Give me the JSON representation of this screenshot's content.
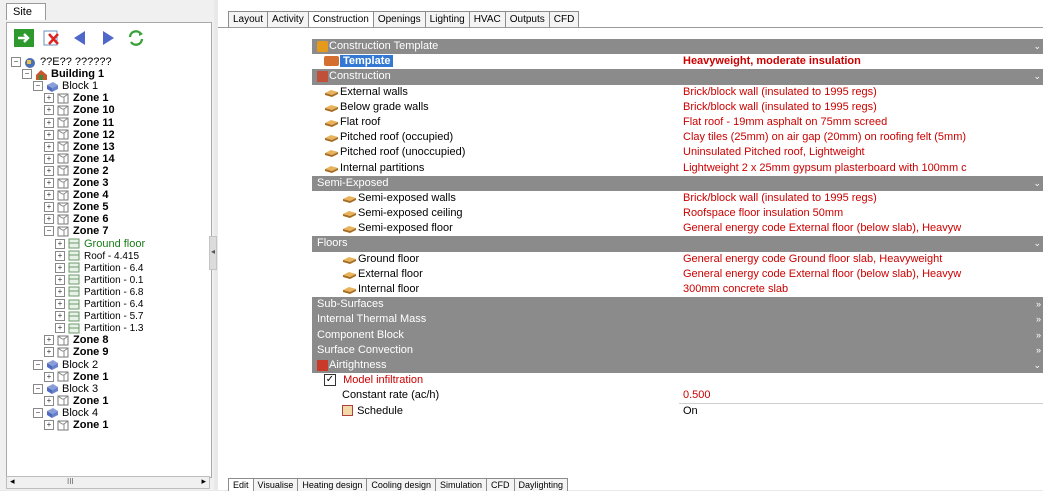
{
  "site_panel": {
    "tab": "Site",
    "toolbar": [
      "go-icon",
      "delete-icon",
      "prev-icon",
      "next-icon",
      "refresh-icon"
    ],
    "tree": [
      {
        "label": "??E?? ??????",
        "level": 0,
        "kind": "site"
      },
      {
        "label": "Building 1",
        "level": 1,
        "kind": "building"
      },
      {
        "label": "Block 1",
        "level": 2,
        "kind": "block"
      },
      {
        "label": "Zone 1",
        "level": 3,
        "kind": "zone"
      },
      {
        "label": "Zone 10",
        "level": 3,
        "kind": "zone"
      },
      {
        "label": "Zone 11",
        "level": 3,
        "kind": "zone"
      },
      {
        "label": "Zone 12",
        "level": 3,
        "kind": "zone"
      },
      {
        "label": "Zone 13",
        "level": 3,
        "kind": "zone"
      },
      {
        "label": "Zone 14",
        "level": 3,
        "kind": "zone"
      },
      {
        "label": "Zone 2",
        "level": 3,
        "kind": "zone"
      },
      {
        "label": "Zone 3",
        "level": 3,
        "kind": "zone"
      },
      {
        "label": "Zone 4",
        "level": 3,
        "kind": "zone"
      },
      {
        "label": "Zone 5",
        "level": 3,
        "kind": "zone"
      },
      {
        "label": "Zone 6",
        "level": 3,
        "kind": "zone"
      },
      {
        "label": "Zone 7",
        "level": 3,
        "kind": "zone"
      },
      {
        "label": "Ground floor",
        "level": 4,
        "kind": "surface-selected"
      },
      {
        "label": "Roof - 4.415",
        "level": 4,
        "kind": "surface"
      },
      {
        "label": "Partition - 6.4",
        "level": 4,
        "kind": "surface"
      },
      {
        "label": "Partition - 0.1",
        "level": 4,
        "kind": "surface"
      },
      {
        "label": "Partition - 6.8",
        "level": 4,
        "kind": "surface"
      },
      {
        "label": "Partition - 6.4",
        "level": 4,
        "kind": "surface"
      },
      {
        "label": "Partition - 5.7",
        "level": 4,
        "kind": "surface"
      },
      {
        "label": "Partition - 1.3",
        "level": 4,
        "kind": "surface"
      },
      {
        "label": "Zone 8",
        "level": 3,
        "kind": "zone"
      },
      {
        "label": "Zone 9",
        "level": 3,
        "kind": "zone"
      },
      {
        "label": "Block 2",
        "level": 2,
        "kind": "block"
      },
      {
        "label": "Zone 1",
        "level": 3,
        "kind": "zone"
      },
      {
        "label": "Block 3",
        "level": 2,
        "kind": "block"
      },
      {
        "label": "Zone 1",
        "level": 3,
        "kind": "zone"
      },
      {
        "label": "Block 4",
        "level": 2,
        "kind": "block"
      },
      {
        "label": "Zone 1",
        "level": 3,
        "kind": "zone"
      }
    ],
    "scroll_label": "III"
  },
  "top_tabs": [
    "Layout",
    "Activity",
    "Construction",
    "Openings",
    "Lighting",
    "HVAC",
    "Outputs",
    "CFD"
  ],
  "active_top_tab": "Construction",
  "sections": {
    "construction_template": "Construction Template",
    "template_label": "Template",
    "template_value": "Heavyweight, moderate insulation",
    "construction": "Construction",
    "semi_exposed": "Semi-Exposed",
    "floors": "Floors",
    "sub_surfaces": "Sub-Surfaces",
    "internal_thermal_mass": "Internal Thermal Mass",
    "component_block": "Component Block",
    "surface_convection": "Surface Convection",
    "airtightness": "Airtightness"
  },
  "construction_rows": [
    {
      "label": "External walls",
      "value": "Brick/block wall (insulated to 1995 regs)"
    },
    {
      "label": "Below grade walls",
      "value": "Brick/block wall (insulated to 1995 regs)"
    },
    {
      "label": "Flat roof",
      "value": "Flat roof - 19mm asphalt on 75mm screed"
    },
    {
      "label": "Pitched roof (occupied)",
      "value": "Clay tiles (25mm) on air gap (20mm) on roofing felt (5mm)"
    },
    {
      "label": "Pitched roof (unoccupied)",
      "value": "Uninsulated Pitched roof, Lightweight"
    },
    {
      "label": "Internal partitions",
      "value": "Lightweight 2 x 25mm gypsum plasterboard with 100mm c"
    }
  ],
  "semi_exposed_rows": [
    {
      "label": "Semi-exposed walls",
      "value": "Brick/block wall (insulated to 1995 regs)"
    },
    {
      "label": "Semi-exposed ceiling",
      "value": "Roofspace floor insulation 50mm"
    },
    {
      "label": "Semi-exposed floor",
      "value": "General energy code External floor (below slab), Heavyw"
    }
  ],
  "floor_rows": [
    {
      "label": "Ground floor",
      "value": "General energy code Ground floor slab, Heavyweight"
    },
    {
      "label": "External floor",
      "value": "General energy code External floor (below slab), Heavyw"
    },
    {
      "label": "Internal floor",
      "value": "300mm concrete slab"
    }
  ],
  "airtightness": {
    "model_infiltration_label": "Model infiltration",
    "model_infiltration_checked": true,
    "constant_rate_label": "Constant rate (ac/h)",
    "constant_rate_value": "0.500",
    "schedule_label": "Schedule",
    "schedule_value": "On"
  },
  "bottom_tabs": [
    "Edit",
    "Visualise",
    "Heating design",
    "Cooling design",
    "Simulation",
    "CFD",
    "Daylighting"
  ],
  "active_bottom_tab": "Edit",
  "colors": {
    "section_header": "#8b8b8b",
    "value_red": "#cc0000",
    "selection": "#3379d4"
  }
}
